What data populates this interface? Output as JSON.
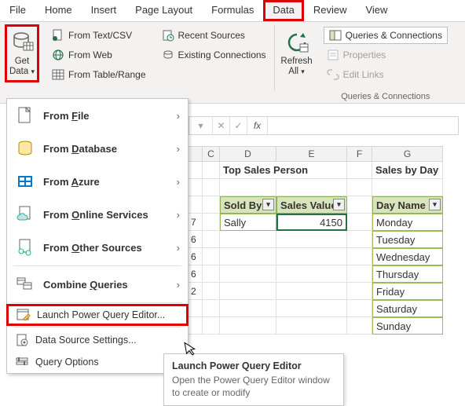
{
  "ribbon": {
    "tabs": [
      "File",
      "Home",
      "Insert",
      "Page Layout",
      "Formulas",
      "Data",
      "Review",
      "View"
    ],
    "active_tab": "Data",
    "get_data": {
      "line1": "Get",
      "line2": "Data"
    },
    "grp1": {
      "csv": "From Text/CSV",
      "web": "From Web",
      "table": "From Table/Range"
    },
    "grp2": {
      "recent": "Recent Sources",
      "existing": "Existing Connections"
    },
    "refresh": {
      "line1": "Refresh",
      "line2": "All"
    },
    "grp3": {
      "queries": "Queries & Connections",
      "props": "Properties",
      "links": "Edit Links",
      "label": "Queries & Connections"
    }
  },
  "dropdown": {
    "items": [
      {
        "pre": "From ",
        "u": "F",
        "post": "ile"
      },
      {
        "pre": "From ",
        "u": "D",
        "post": "atabase"
      },
      {
        "pre": "From ",
        "u": "A",
        "post": "zure"
      },
      {
        "pre": "From ",
        "u": "O",
        "post": "nline Services"
      },
      {
        "pre": "From ",
        "u": "O",
        "post": "ther Sources"
      },
      {
        "pre": "Combine ",
        "u": "Q",
        "post": "ueries"
      }
    ],
    "launch": "Launch Power Query Editor...",
    "dss": "Data Source Settings...",
    "qopt": "Query Options"
  },
  "formula_bar": {
    "fx": "fx"
  },
  "grid": {
    "cols": [
      "C",
      "D",
      "E",
      "F",
      "G"
    ],
    "titles": {
      "top_sales": "Top Sales Person",
      "sales_by_day": "Sales by Day"
    },
    "headers": {
      "sold_by": "Sold By",
      "sales_value": "Sales Value",
      "day_name": "Day Name"
    },
    "row1": {
      "sold_by": "Sally",
      "sales_value": "4150"
    },
    "days": [
      "Monday",
      "Tuesday",
      "Wednesday",
      "Thursday",
      "Friday",
      "Saturday",
      "Sunday"
    ],
    "stub": [
      "7",
      "6",
      "6",
      "6",
      "2"
    ]
  },
  "tooltip": {
    "title": "Launch Power Query Editor",
    "desc": "Open the Power Query Editor window to create or modify"
  },
  "icons": {
    "db": "#6a6a6a",
    "green": "#217346",
    "blue": "#2b579a",
    "orange": "#d83b01"
  }
}
